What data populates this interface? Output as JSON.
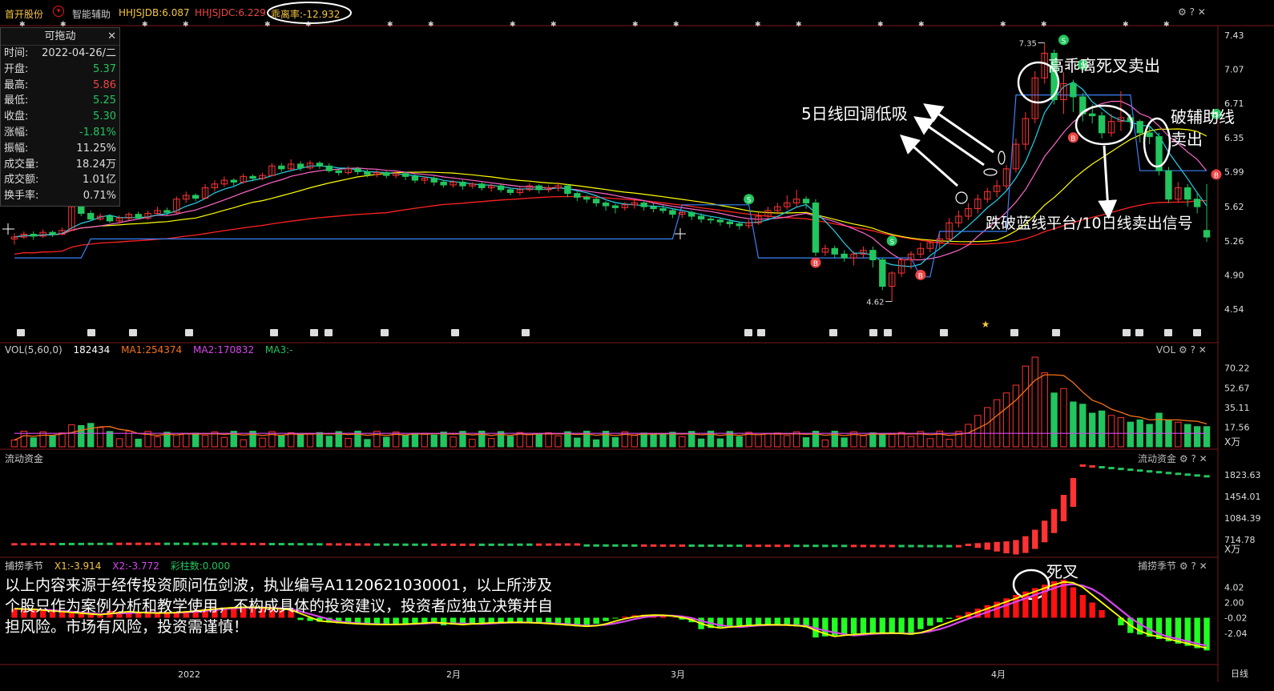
{
  "topbar": {
    "stock_name": "首开股份",
    "indicator_name": "智能辅助",
    "hhjsjdb": "HHJSJDB:6.087",
    "hhjsjdc": "HHJSJDC:6.229",
    "deviation": "乖离率:-12.932"
  },
  "info_box": {
    "title": "可拖动",
    "rows": [
      {
        "label": "时间:",
        "value": "2022-04-26/二",
        "color": "#dddddd"
      },
      {
        "label": "开盘:",
        "value": "5.37",
        "color": "#22c55e"
      },
      {
        "label": "最高:",
        "value": "5.86",
        "color": "#ef4444"
      },
      {
        "label": "最低:",
        "value": "5.25",
        "color": "#22c55e"
      },
      {
        "label": "收盘:",
        "value": "5.30",
        "color": "#22c55e"
      },
      {
        "label": "涨幅:",
        "value": "-1.81%",
        "color": "#22c55e"
      },
      {
        "label": "振幅:",
        "value": "11.25%",
        "color": "#dddddd"
      },
      {
        "label": "成交量:",
        "value": "18.24万",
        "color": "#dddddd"
      },
      {
        "label": "成交额:",
        "value": "1.01亿",
        "color": "#dddddd"
      },
      {
        "label": "换手率:",
        "value": "0.71%",
        "color": "#dddddd"
      }
    ]
  },
  "price_axis": [
    "7.43",
    "7.07",
    "6.71",
    "6.35",
    "5.99",
    "5.62",
    "5.26",
    "4.90",
    "4.54"
  ],
  "price_marks": {
    "high": "7.35",
    "low": "4.62"
  },
  "volume_panel": {
    "label": "VOL(5,60,0)",
    "value": "182434",
    "ma1": "MA1:254374",
    "ma2": "MA2:170832",
    "ma3": "MA3:-",
    "right_label": "VOL",
    "axis": [
      "70.22",
      "52.67",
      "35.11",
      "17.56"
    ],
    "unit": "X万"
  },
  "flow_panel": {
    "label": "流动资金",
    "right_label": "流动资金",
    "axis": [
      "1823.63",
      "1454.01",
      "1084.39",
      "714.78"
    ],
    "unit": "X万"
  },
  "season_panel": {
    "label": "捕捞季节",
    "x1": "X1:-3.914",
    "x2": "X2:-3.772",
    "bars": "彩柱数:0.000",
    "right_label": "捕捞季节",
    "axis": [
      "4.02",
      "2.00",
      "-0.02",
      "-2.04"
    ]
  },
  "date_axis": {
    "labels": [
      "2022",
      "2月",
      "3月",
      "4月"
    ],
    "unit": "日线"
  },
  "annotations": {
    "high_deviation": "高乖离死叉卖出",
    "ma5_pullback": "5日线回调低吸",
    "break_aux_line1": "破辅助线",
    "break_aux_line2": "卖出",
    "break_platform": "跌破蓝线平台/10日线卖出信号",
    "death_cross": "死叉"
  },
  "disclaimer": "以上内容来源于经传投资顾问伍剑波，执业编号A1120621030001，以上所涉及个股只作为案例分析和教学使用，不构成具体的投资建议，投资者应独立决策并自担风险。市场有风险，投资需谨慎！",
  "colors": {
    "up": "#ff3333",
    "down": "#22c55e",
    "ma5": "#ffffff",
    "ma10": "#22d3ee",
    "ma20": "#ff66cc",
    "ma30": "#ffff00",
    "ma60": "#ff2222",
    "platform": "#3b82f6"
  },
  "chart_data": {
    "type": "candlestick",
    "y_range": [
      4.54,
      7.43
    ],
    "low_value": 4.62,
    "high_value": 7.35,
    "candles": [
      [
        5.28,
        5.3,
        5.22,
        5.34
      ],
      [
        5.3,
        5.33,
        5.28,
        5.36
      ],
      [
        5.33,
        5.31,
        5.27,
        5.36
      ],
      [
        5.31,
        5.35,
        5.29,
        5.38
      ],
      [
        5.35,
        5.33,
        5.3,
        5.37
      ],
      [
        5.33,
        5.37,
        5.32,
        5.4
      ],
      [
        5.37,
        5.62,
        5.36,
        5.66
      ],
      [
        5.62,
        5.55,
        5.52,
        5.64
      ],
      [
        5.55,
        5.49,
        5.47,
        5.58
      ],
      [
        5.49,
        5.52,
        5.47,
        5.55
      ],
      [
        5.52,
        5.47,
        5.45,
        5.54
      ],
      [
        5.47,
        5.5,
        5.44,
        5.53
      ],
      [
        5.5,
        5.54,
        5.48,
        5.56
      ],
      [
        5.54,
        5.5,
        5.49,
        5.57
      ],
      [
        5.5,
        5.55,
        5.48,
        5.58
      ],
      [
        5.55,
        5.58,
        5.52,
        5.62
      ],
      [
        5.58,
        5.56,
        5.53,
        5.61
      ],
      [
        5.56,
        5.7,
        5.55,
        5.73
      ],
      [
        5.7,
        5.74,
        5.66,
        5.78
      ],
      [
        5.74,
        5.71,
        5.68,
        5.76
      ],
      [
        5.71,
        5.82,
        5.7,
        5.86
      ],
      [
        5.82,
        5.86,
        5.78,
        5.9
      ],
      [
        5.86,
        5.9,
        5.83,
        5.94
      ],
      [
        5.9,
        5.88,
        5.84,
        5.92
      ],
      [
        5.88,
        5.94,
        5.86,
        5.97
      ],
      [
        5.94,
        5.92,
        5.89,
        5.96
      ],
      [
        5.92,
        5.95,
        5.9,
        5.98
      ],
      [
        5.95,
        6.05,
        5.94,
        6.08
      ],
      [
        6.05,
        6.02,
        5.99,
        6.08
      ],
      [
        6.02,
        6.07,
        6.0,
        6.12
      ],
      [
        6.07,
        6.03,
        6.0,
        6.1
      ],
      [
        6.03,
        6.08,
        6.01,
        6.11
      ],
      [
        6.08,
        6.05,
        6.02,
        6.1
      ],
      [
        6.05,
        6.0,
        5.98,
        6.08
      ],
      [
        6.0,
        5.98,
        5.95,
        6.02
      ],
      [
        5.98,
        6.02,
        5.96,
        6.05
      ],
      [
        6.02,
        5.99,
        5.96,
        6.04
      ],
      [
        5.99,
        5.96,
        5.93,
        6.01
      ],
      [
        5.96,
        5.98,
        5.93,
        6.01
      ],
      [
        5.98,
        5.95,
        5.92,
        6.0
      ],
      [
        5.95,
        5.97,
        5.92,
        6.0
      ],
      [
        5.97,
        5.94,
        5.9,
        5.99
      ],
      [
        5.94,
        5.9,
        5.87,
        5.96
      ],
      [
        5.9,
        5.92,
        5.86,
        5.94
      ],
      [
        5.92,
        5.88,
        5.84,
        5.94
      ],
      [
        5.88,
        5.85,
        5.82,
        5.9
      ],
      [
        5.85,
        5.88,
        5.82,
        5.9
      ],
      [
        5.88,
        5.84,
        5.8,
        5.9
      ],
      [
        5.84,
        5.86,
        5.81,
        5.88
      ],
      [
        5.86,
        5.82,
        5.79,
        5.88
      ],
      [
        5.82,
        5.84,
        5.78,
        5.86
      ],
      [
        5.84,
        5.8,
        5.77,
        5.86
      ],
      [
        5.8,
        5.77,
        5.74,
        5.82
      ],
      [
        5.77,
        5.8,
        5.74,
        5.83
      ],
      [
        5.8,
        5.84,
        5.78,
        5.87
      ],
      [
        5.84,
        5.8,
        5.76,
        5.86
      ],
      [
        5.8,
        5.82,
        5.77,
        5.85
      ],
      [
        5.82,
        5.84,
        5.78,
        5.88
      ],
      [
        5.84,
        5.76,
        5.72,
        5.86
      ],
      [
        5.76,
        5.72,
        5.68,
        5.78
      ],
      [
        5.72,
        5.7,
        5.66,
        5.74
      ],
      [
        5.7,
        5.66,
        5.62,
        5.72
      ],
      [
        5.66,
        5.63,
        5.58,
        5.68
      ],
      [
        5.63,
        5.61,
        5.55,
        5.65
      ],
      [
        5.61,
        5.64,
        5.58,
        5.67
      ],
      [
        5.64,
        5.66,
        5.6,
        5.7
      ],
      [
        5.66,
        5.62,
        5.58,
        5.68
      ],
      [
        5.62,
        5.6,
        5.56,
        5.66
      ],
      [
        5.6,
        5.58,
        5.55,
        5.64
      ],
      [
        5.58,
        5.54,
        5.5,
        5.6
      ],
      [
        5.54,
        5.56,
        5.5,
        5.58
      ],
      [
        5.56,
        5.52,
        5.48,
        5.58
      ],
      [
        5.52,
        5.49,
        5.45,
        5.55
      ],
      [
        5.49,
        5.48,
        5.44,
        5.52
      ],
      [
        5.48,
        5.46,
        5.42,
        5.5
      ],
      [
        5.46,
        5.44,
        5.4,
        5.49
      ],
      [
        5.44,
        5.42,
        5.38,
        5.46
      ],
      [
        5.42,
        5.45,
        5.39,
        5.48
      ],
      [
        5.45,
        5.52,
        5.43,
        5.56
      ],
      [
        5.52,
        5.58,
        5.5,
        5.62
      ],
      [
        5.58,
        5.62,
        5.54,
        5.66
      ],
      [
        5.62,
        5.66,
        5.59,
        5.74
      ],
      [
        5.66,
        5.7,
        5.62,
        5.8
      ],
      [
        5.7,
        5.66,
        5.6,
        5.73
      ],
      [
        5.66,
        5.14,
        5.1,
        5.7
      ],
      [
        5.14,
        5.18,
        5.1,
        5.22
      ],
      [
        5.18,
        5.12,
        5.08,
        5.21
      ],
      [
        5.12,
        5.08,
        5.04,
        5.16
      ],
      [
        5.08,
        5.12,
        5.0,
        5.15
      ],
      [
        5.12,
        5.16,
        5.08,
        5.2
      ],
      [
        5.16,
        5.06,
        4.98,
        5.2
      ],
      [
        5.06,
        4.78,
        4.74,
        5.08
      ],
      [
        4.78,
        4.92,
        4.62,
        4.94
      ],
      [
        4.92,
        5.06,
        4.88,
        5.08
      ],
      [
        5.06,
        5.12,
        4.96,
        5.15
      ],
      [
        5.12,
        5.18,
        5.08,
        5.24
      ],
      [
        5.18,
        5.24,
        5.14,
        5.28
      ],
      [
        5.24,
        5.28,
        5.18,
        5.34
      ],
      [
        5.28,
        5.45,
        5.25,
        5.5
      ],
      [
        5.45,
        5.52,
        5.4,
        5.58
      ],
      [
        5.52,
        5.6,
        5.48,
        5.66
      ],
      [
        5.6,
        5.7,
        5.55,
        5.75
      ],
      [
        5.7,
        5.78,
        5.66,
        5.82
      ],
      [
        5.78,
        5.84,
        5.72,
        5.9
      ],
      [
        5.84,
        6.02,
        5.8,
        6.06
      ],
      [
        6.02,
        6.28,
        5.98,
        6.34
      ],
      [
        6.28,
        6.55,
        6.22,
        6.62
      ],
      [
        6.55,
        6.98,
        6.5,
        7.05
      ],
      [
        6.98,
        7.24,
        6.92,
        7.35
      ],
      [
        7.24,
        6.75,
        6.7,
        7.28
      ],
      [
        6.75,
        6.92,
        6.6,
        7.04
      ],
      [
        6.92,
        6.78,
        6.62,
        6.96
      ],
      [
        6.78,
        6.6,
        6.52,
        6.82
      ],
      [
        6.6,
        6.58,
        6.5,
        6.7
      ],
      [
        6.58,
        6.4,
        6.34,
        6.62
      ],
      [
        6.4,
        6.52,
        6.36,
        6.6
      ],
      [
        6.52,
        6.56,
        6.42,
        6.84
      ],
      [
        6.56,
        6.52,
        6.44,
        6.6
      ],
      [
        6.52,
        6.4,
        6.3,
        6.54
      ],
      [
        6.4,
        6.36,
        6.28,
        6.46
      ],
      [
        6.36,
        6.0,
        5.95,
        6.4
      ],
      [
        6.0,
        5.7,
        5.66,
        6.04
      ],
      [
        5.7,
        5.82,
        5.66,
        5.88
      ],
      [
        5.82,
        5.7,
        5.62,
        5.86
      ],
      [
        5.7,
        5.62,
        5.55,
        5.76
      ],
      [
        5.37,
        5.3,
        5.25,
        5.86
      ]
    ]
  }
}
